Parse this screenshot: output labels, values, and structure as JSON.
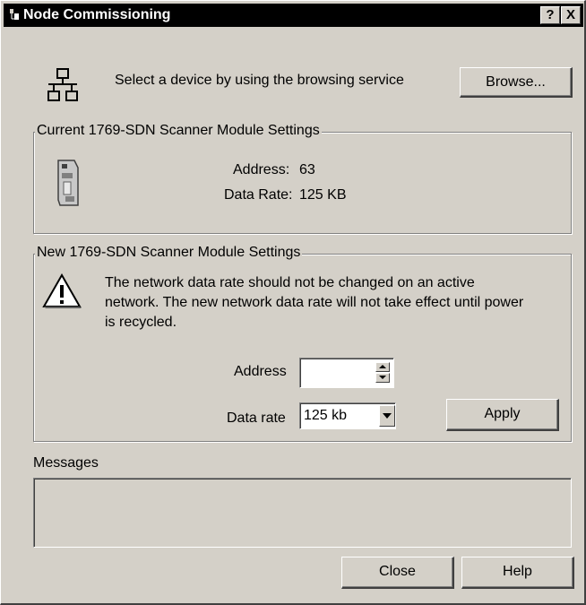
{
  "window": {
    "title": "Node Commissioning",
    "help_glyph": "?",
    "close_glyph": "X"
  },
  "browse": {
    "prompt": "Select a device by using the browsing service",
    "button_label": "Browse...",
    "icon": "network-tree-icon"
  },
  "current_settings": {
    "legend": "Current 1769-SDN Scanner Module Settings",
    "address_label": "Address:",
    "address_value": "63",
    "rate_label": "Data Rate:",
    "rate_value": "125 KB",
    "icon": "scanner-module-icon"
  },
  "new_settings": {
    "legend": "New 1769-SDN Scanner Module Settings",
    "warning_line1": "The network data rate should not be changed on an active",
    "warning_line2": "network. The new network data rate will not take effect until power",
    "warning_line3": "is recycled.",
    "warning_icon": "warning-icon",
    "address_label": "Address",
    "address_value": "",
    "rate_label": "Data rate",
    "rate_selected": "125 kb",
    "apply_label": "Apply"
  },
  "messages": {
    "label": "Messages",
    "content": ""
  },
  "footer": {
    "close_label": "Close",
    "help_label": "Help"
  }
}
